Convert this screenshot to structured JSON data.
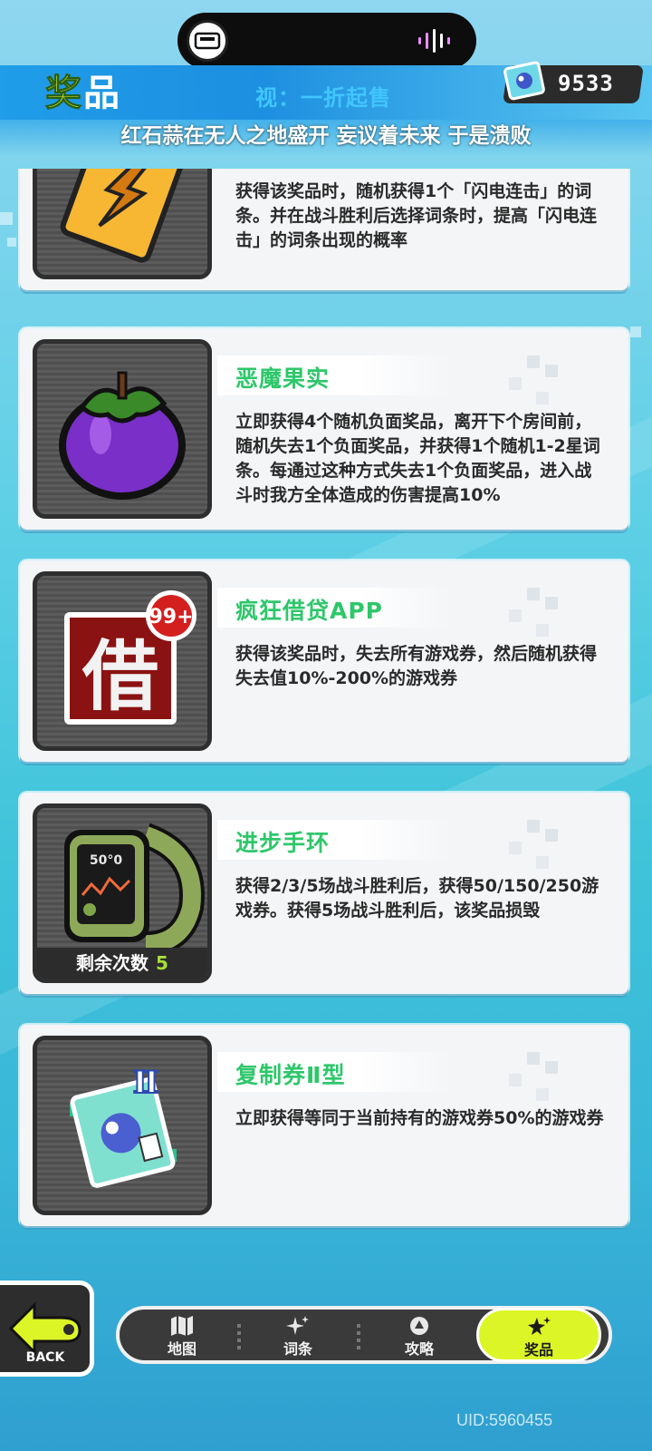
{
  "header": {
    "title_part1": "奖",
    "title_part2": "品",
    "subtitle": "视：一折起售",
    "currency_value": "9533",
    "lyric": "红石蒜在无人之地盛开 妄议着未来 于是溃败"
  },
  "items": [
    {
      "name": "",
      "description": "获得该奖品时，随机获得1个「闪电连击」的词条。并在战斗胜利后选择词条时，提高「闪电连击」的词条出现的概率",
      "icon": "lightning-card-icon"
    },
    {
      "name": "恶魔果实",
      "description": "立即获得4个随机负面奖品，离开下个房间前，随机失去1个负面奖品，并获得1个随机1-2星词条。每通过这种方式失去1个负面奖品，进入战斗时我方全体造成的伤害提高10%",
      "icon": "devil-fruit-icon"
    },
    {
      "name": "疯狂借贷APP",
      "description": "获得该奖品时，失去所有游戏券，然后随机获得失去值10%-200%的游戏券",
      "icon": "loan-app-icon",
      "badge": "99+",
      "glyph": "借"
    },
    {
      "name": "进步手环",
      "description": "获得2/3/5场战斗胜利后，获得50/150/250游戏券。获得5场战斗胜利后，该奖品损毁",
      "icon": "progress-watch-icon",
      "watch_screen": "50°0",
      "remaining_label": "剩余次数",
      "remaining_count": "5"
    },
    {
      "name": "复制券Ⅱ型",
      "description": "立即获得等同于当前持有的游戏券50%的游戏券",
      "icon": "copy-ticket-icon",
      "roman": "Ⅱ"
    }
  ],
  "nav": {
    "back_label": "BACK",
    "tabs": [
      {
        "label": "地图",
        "icon": "map-icon"
      },
      {
        "label": "词条",
        "icon": "sparkle-icon"
      },
      {
        "label": "攻略",
        "icon": "guide-icon"
      },
      {
        "label": "奖品",
        "icon": "prize-icon",
        "active": true
      }
    ]
  },
  "uid": "UID:5960455",
  "colors": {
    "accent_green": "#2ec76a",
    "active_tab": "#dcf526",
    "header_blue": "#1f9de8"
  }
}
